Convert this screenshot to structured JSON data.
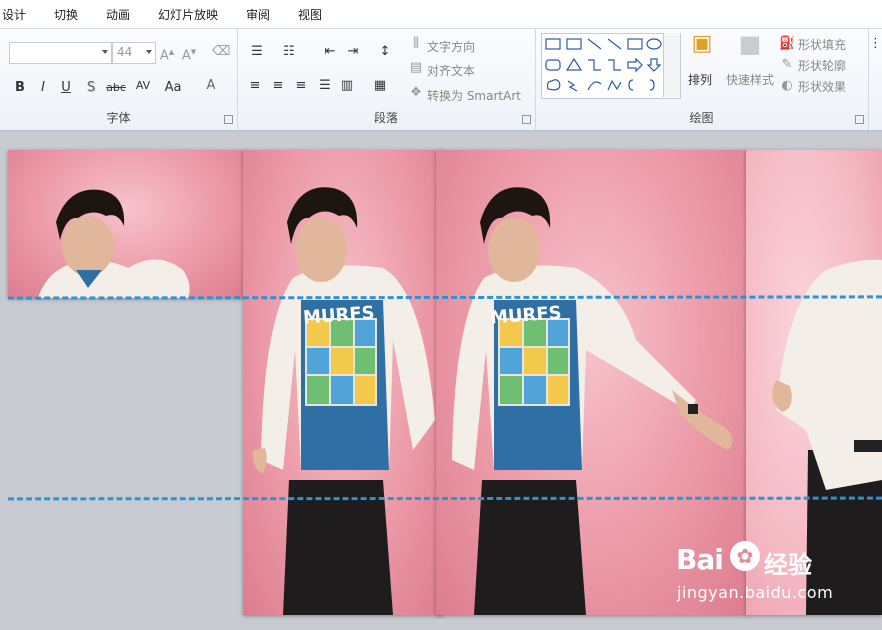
{
  "menu": {
    "tabs": [
      "设计",
      "切换",
      "动画",
      "幻灯片放映",
      "审阅",
      "视图"
    ]
  },
  "ribbon": {
    "font_group": {
      "label": "字体",
      "font_size": "44",
      "buttons": [
        "B",
        "I",
        "U",
        "S",
        "abc",
        "AV",
        "Aa",
        "A"
      ]
    },
    "paragraph_group": {
      "label": "段落",
      "text_direction": "文字方向",
      "align_text": "对齐文本",
      "convert_smartart": "转换为 SmartArt"
    },
    "drawing_group": {
      "label": "绘图",
      "arrange": "排列",
      "quick_styles": "快速样式",
      "shape_fill": "形状填充",
      "shape_outline": "形状轮廓",
      "shape_effects": "形状效果"
    }
  },
  "canvas": {
    "background": "#c8ccd2",
    "slide_colors": [
      "#ec9aa8",
      "#f4b8c2"
    ],
    "guide_color": "#2b93d6",
    "shirt_text": "MURFS"
  },
  "watermark": {
    "brand": "Bai",
    "brand_cn": "经验",
    "url": "jingyan.baidu.com"
  }
}
